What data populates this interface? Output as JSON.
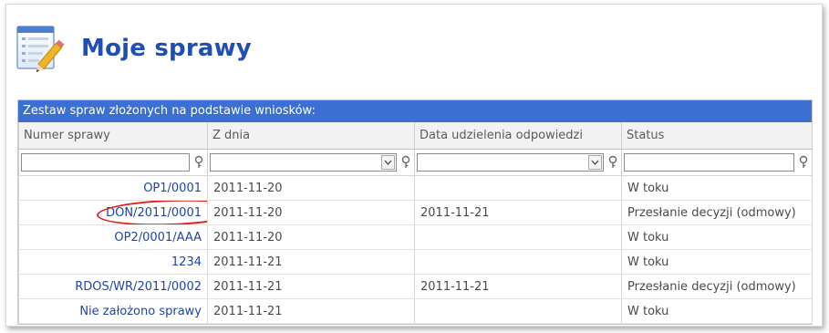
{
  "page": {
    "title": "Moje sprawy",
    "icon": "notepad-pencil-icon"
  },
  "panel": {
    "header": "Zestaw spraw złożonych na podstawie wniosków:",
    "columns": [
      "Numer sprawy",
      "Z dnia",
      "Data udzielenia odpowiedzi",
      "Status"
    ],
    "filters": [
      {
        "value": "",
        "has_dropdown": false
      },
      {
        "value": "",
        "has_dropdown": true
      },
      {
        "value": "",
        "has_dropdown": true
      },
      {
        "value": "",
        "has_dropdown": false
      }
    ],
    "rows": [
      {
        "numer": "OP1/0001",
        "z_dnia": "2011-11-20",
        "data_odp": "",
        "status": "W toku"
      },
      {
        "numer": "DON/2011/0001",
        "z_dnia": "2011-11-20",
        "data_odp": "2011-11-21",
        "status": "Przesłanie decyzji (odmowy)",
        "highlighted": true
      },
      {
        "numer": "OP2/0001/AAA",
        "z_dnia": "2011-11-20",
        "data_odp": "",
        "status": "W toku"
      },
      {
        "numer": "1234",
        "z_dnia": "2011-11-21",
        "data_odp": "",
        "status": "W toku"
      },
      {
        "numer": "RDOS/WR/2011/0002",
        "z_dnia": "2011-11-21",
        "data_odp": "2011-11-21",
        "status": "Przesłanie decyzji (odmowy)"
      },
      {
        "numer": "Nie założono sprawy",
        "z_dnia": "2011-11-21",
        "data_odp": "",
        "status": "W toku"
      }
    ]
  },
  "colors": {
    "accent": "#1f4fb5",
    "header_bar": "#3b6fd1",
    "link": "#2145a6",
    "highlight_oval": "#e02020"
  }
}
